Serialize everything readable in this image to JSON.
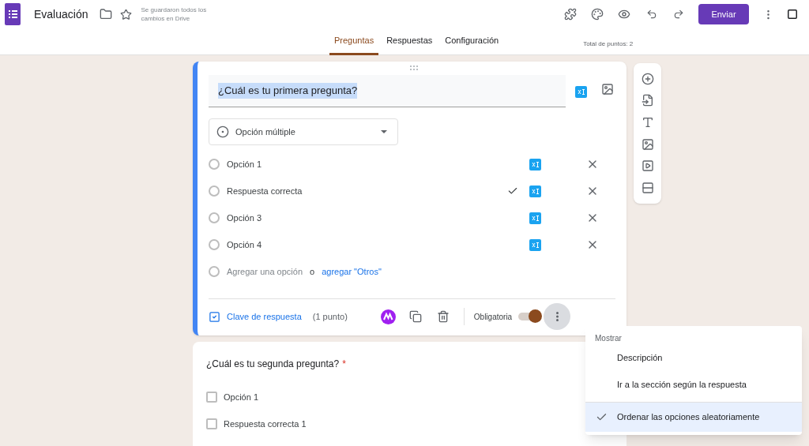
{
  "header": {
    "title": "Evaluación",
    "save_status": "Se guardaron todos los cambios en Drive",
    "send_button": "Enviar"
  },
  "tabs": [
    {
      "label": "Preguntas",
      "selected": true
    },
    {
      "label": "Respuestas",
      "selected": false
    },
    {
      "label": "Configuración",
      "selected": false
    }
  ],
  "total_points": "Total de puntos: 2",
  "questions": [
    {
      "title": "¿Cuál es tu primera pregunta?",
      "kind": "radio",
      "active": true,
      "type_label": "Opción múltiple",
      "options": [
        {
          "label": "Opción 1",
          "correct": false,
          "checked": false
        },
        {
          "label": "Respuesta correcta",
          "correct": true,
          "checked": false
        },
        {
          "label": "Opción 3",
          "correct": false,
          "checked": false
        },
        {
          "label": "Opción 4",
          "correct": false,
          "checked": false
        }
      ],
      "add_option": "Agregar una opción",
      "add_or": "o",
      "add_other": "agregar \"Otros\"",
      "answer_key": "Clave de respuesta",
      "points": "(1 punto)",
      "required_label": "Obligatoria",
      "required": true
    },
    {
      "title": "¿Cuál es tu segunda pregunta?",
      "required_mark": "*",
      "kind": "checkbox",
      "active": false,
      "options": [
        {
          "label": "Opción 1",
          "checked": false
        },
        {
          "label": "Respuesta correcta 1",
          "checked": false
        }
      ]
    }
  ],
  "menu": {
    "heading": "Mostrar",
    "items": [
      {
        "label": "Descripción",
        "checked": false
      },
      {
        "label": "Ir a la sección según la respuesta",
        "checked": false
      },
      {
        "label": "Ordenar las opciones aleatoriamente",
        "checked": true
      }
    ]
  }
}
